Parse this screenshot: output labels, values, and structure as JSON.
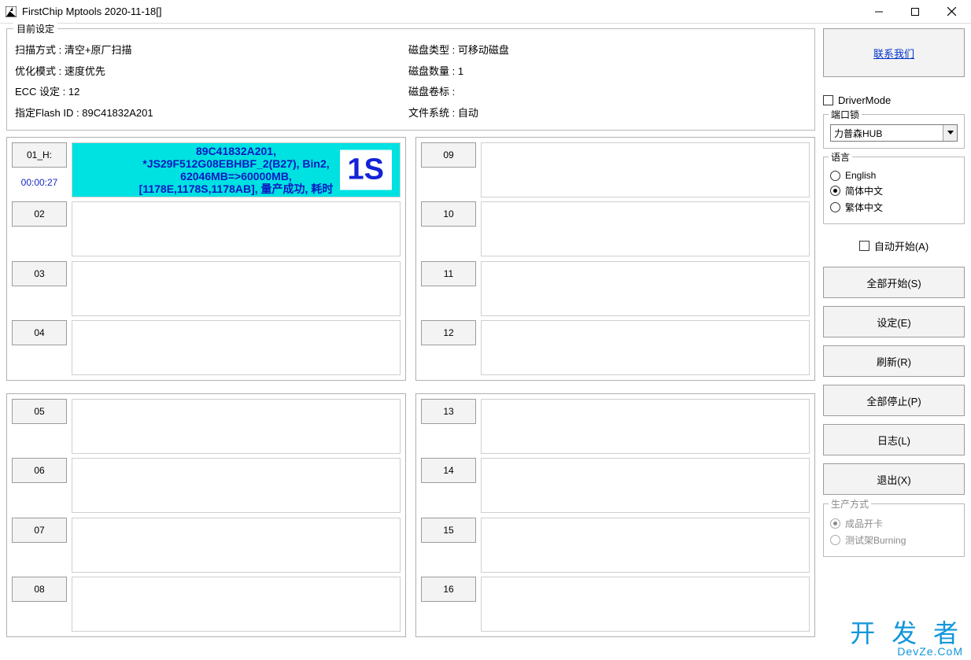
{
  "window": {
    "title": "FirstChip Mptools    2020-11-18[]"
  },
  "settings": {
    "legend": "目前设定",
    "left": {
      "scan_mode_label": "扫描方式 :",
      "scan_mode_value": "清空+原厂扫描",
      "opt_mode_label": "优化模式 :",
      "opt_mode_value": "速度优先",
      "ecc_label": "ECC 设定 :",
      "ecc_value": "12",
      "flashid_label": "指定Flash ID :",
      "flashid_value": "89C41832A201"
    },
    "right": {
      "disk_type_label": "磁盘类型 :",
      "disk_type_value": "可移动磁盘",
      "disk_count_label": "磁盘数量 :",
      "disk_count_value": "1",
      "disk_label_label": "磁盘卷标 :",
      "disk_label_value": "",
      "fs_label": "文件系统 :",
      "fs_value": "自动"
    }
  },
  "ports": {
    "q1": [
      "01_H:",
      "02",
      "03",
      "04"
    ],
    "q2": [
      "09",
      "10",
      "11",
      "12"
    ],
    "q3": [
      "05",
      "06",
      "07",
      "08"
    ],
    "q4": [
      "13",
      "14",
      "15",
      "16"
    ]
  },
  "port01": {
    "time": "00:00:27",
    "line1": "89C41832A201,",
    "line2": "*JS29F512G08EBHBF_2(B27), Bin2,",
    "line3": "62046MB=>60000MB,",
    "line4": "[1178E,1178S,1178AB], 量产成功, 耗时",
    "status": "1S"
  },
  "right": {
    "contact": "联系我们",
    "driver_mode": "DriverMode",
    "port_lock_legend": "端口锁",
    "port_lock_value": "力普森HUB",
    "lang_legend": "语言",
    "lang_en": "English",
    "lang_sc": "简体中文",
    "lang_tc": "繁体中文",
    "auto_start": "自动开始(A)",
    "btn_start_all": "全部开始(S)",
    "btn_settings": "设定(E)",
    "btn_refresh": "刷新(R)",
    "btn_stop_all": "全部停止(P)",
    "btn_log": "日志(L)",
    "btn_exit": "退出(X)",
    "prod_legend": "生产方式",
    "prod_opt1": "成品开卡",
    "prod_opt2": "测试架Burning"
  },
  "watermark": {
    "big": "开 发 者",
    "small": "DevZe.CoM"
  }
}
